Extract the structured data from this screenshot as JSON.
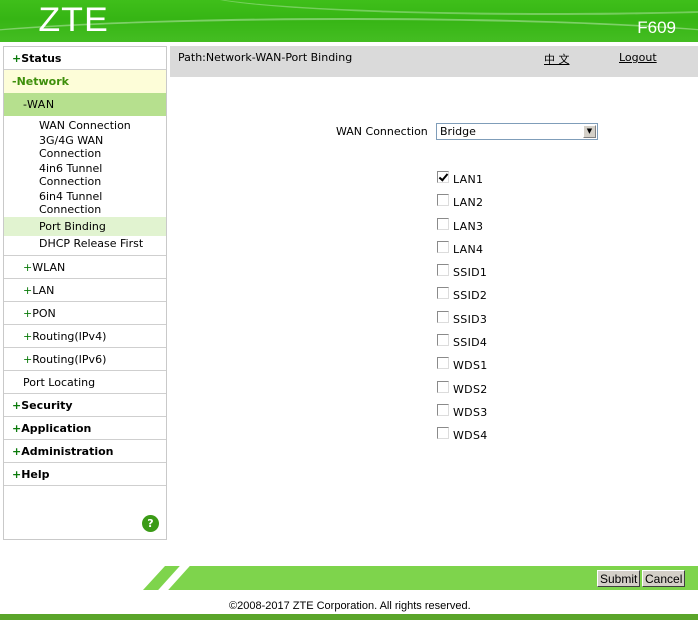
{
  "header": {
    "logo": "ZTE",
    "model": "F609"
  },
  "sidebar": {
    "items": [
      {
        "sign": "+",
        "label": "Status"
      },
      {
        "sign": "-",
        "label": "Network"
      }
    ],
    "network": {
      "wan": {
        "sign": "-",
        "label": "WAN"
      },
      "wan_children": [
        {
          "label": "WAN Connection"
        },
        {
          "label": "3G/4G WAN Connection"
        },
        {
          "label": "4in6 Tunnel Connection"
        },
        {
          "label": "6in4 Tunnel Connection"
        },
        {
          "label": "Port Binding",
          "active": true
        },
        {
          "label": "DHCP Release First"
        }
      ],
      "subs": [
        {
          "sign": "+",
          "label": "WLAN"
        },
        {
          "sign": "+",
          "label": "LAN"
        },
        {
          "sign": "+",
          "label": "PON"
        },
        {
          "sign": "+",
          "label": "Routing(IPv4)"
        },
        {
          "sign": "+",
          "label": "Routing(IPv6)"
        },
        {
          "sign": "",
          "label": "Port Locating"
        }
      ]
    },
    "bottom_items": [
      {
        "sign": "+",
        "label": "Security"
      },
      {
        "sign": "+",
        "label": "Application"
      },
      {
        "sign": "+",
        "label": "Administration"
      },
      {
        "sign": "+",
        "label": "Help"
      }
    ],
    "help_icon": "?"
  },
  "pathbar": {
    "path": "Path:Network-WAN-Port Binding",
    "language": "中 文",
    "logout": "Logout"
  },
  "form": {
    "wan_label": "WAN Connection",
    "wan_selected": "Bridge",
    "ports": [
      {
        "label": "LAN1",
        "checked": true
      },
      {
        "label": "LAN2",
        "checked": false
      },
      {
        "label": "LAN3",
        "checked": false
      },
      {
        "label": "LAN4",
        "checked": false
      },
      {
        "label": "SSID1",
        "checked": false
      },
      {
        "label": "SSID2",
        "checked": false
      },
      {
        "label": "SSID3",
        "checked": false
      },
      {
        "label": "SSID4",
        "checked": false
      },
      {
        "label": "WDS1",
        "checked": false
      },
      {
        "label": "WDS2",
        "checked": false
      },
      {
        "label": "WDS3",
        "checked": false
      },
      {
        "label": "WDS4",
        "checked": false
      }
    ]
  },
  "buttons": {
    "submit": "Submit",
    "cancel": "Cancel"
  },
  "footer": {
    "copyright": "©2008-2017 ZTE Corporation. All rights reserved."
  },
  "colors": {
    "brand_green": "#36b514",
    "bar_green": "#7ed44c",
    "footer_green": "#5aa52a",
    "highlight": "#b6e08e"
  }
}
